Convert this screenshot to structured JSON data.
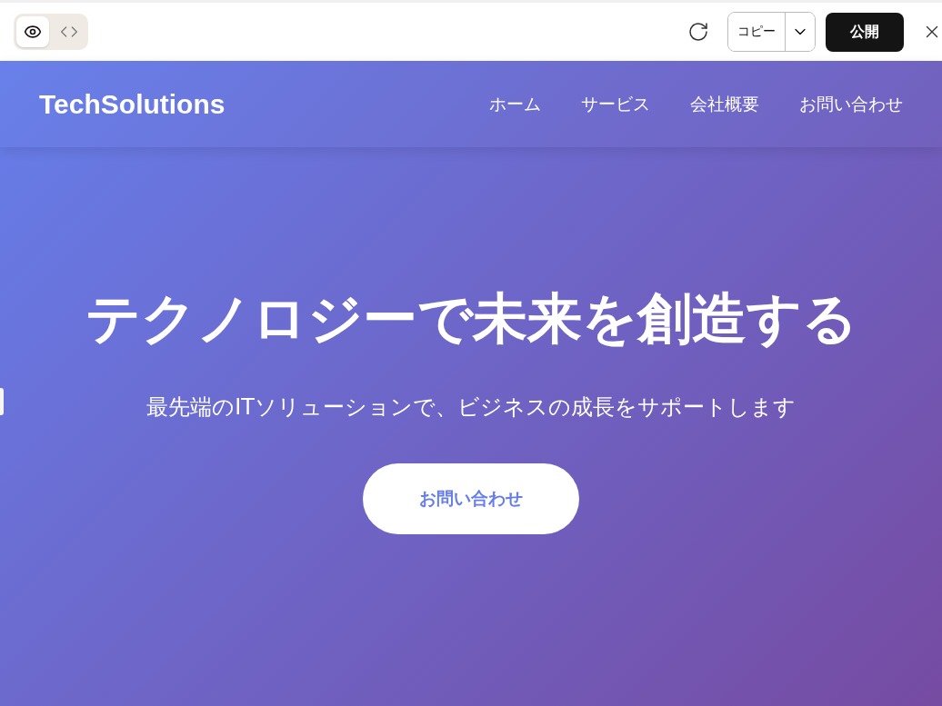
{
  "toolbar": {
    "view_modes": [
      {
        "kind": "preview",
        "selected": true
      },
      {
        "kind": "code",
        "selected": false
      }
    ],
    "copy_button": "コピー",
    "publish_button": "公開"
  },
  "site": {
    "logo": "TechSolutions",
    "nav": [
      "ホーム",
      "サービス",
      "会社概要",
      "お問い合わせ"
    ],
    "hero": {
      "title": "テクノロジーで未来を創造する",
      "subtitle": "最先端のITソリューションで、ビジネスの成長をサポートします",
      "cta": "お問い合わせ"
    }
  }
}
